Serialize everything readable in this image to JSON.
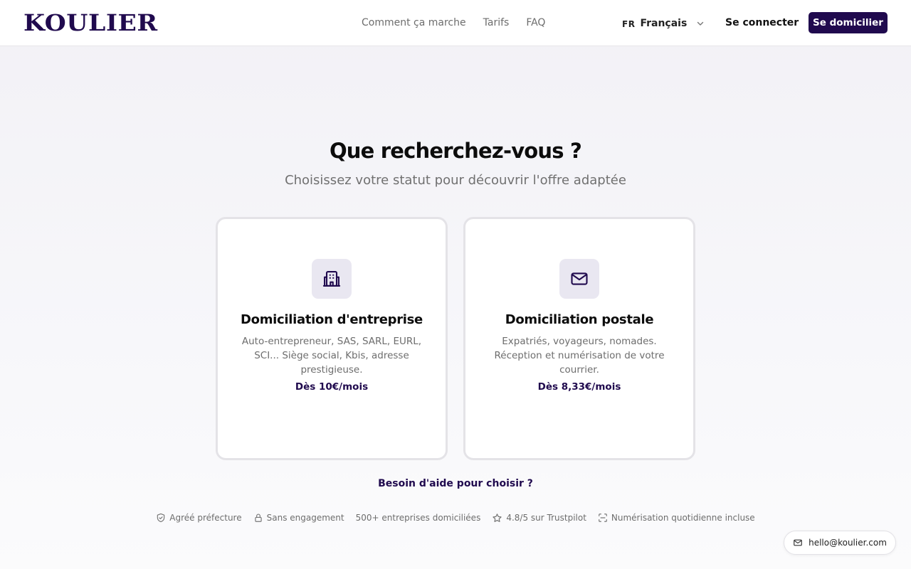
{
  "brand": {
    "logo_text": "KOULIER",
    "color": "#200a4e"
  },
  "nav": {
    "links": [
      "Comment ça marche",
      "Tarifs",
      "FAQ"
    ],
    "language": {
      "code": "FR",
      "label": "Français"
    },
    "login_label": "Se connecter",
    "cta_label": "Se domicilier"
  },
  "hero": {
    "title": "Que recherchez-vous ?",
    "subtitle": "Choisissez votre statut pour découvrir l'offre adaptée"
  },
  "cards": [
    {
      "icon": "building-icon",
      "title": "Domiciliation d'entreprise",
      "description": "Auto-entrepreneur, SAS, SARL, EURL, SCI... Siège social, Kbis, adresse prestigieuse.",
      "price": "Dès 10€/mois"
    },
    {
      "icon": "mail-icon",
      "title": "Domiciliation postale",
      "description": "Expatriés, voyageurs, nomades. Réception et numérisation de votre courrier.",
      "price": "Dès 8,33€/mois"
    }
  ],
  "help_link": "Besoin d'aide pour choisir ?",
  "badges": [
    {
      "icon": "shield-check-icon",
      "label": "Agréé préfecture"
    },
    {
      "icon": "lock-icon",
      "label": "Sans engagement"
    },
    {
      "icon": "",
      "label": "500+ entreprises domiciliées"
    },
    {
      "icon": "star-icon",
      "label": "4.8/5 sur Trustpilot"
    },
    {
      "icon": "scan-icon",
      "label": "Numérisation quotidienne incluse"
    }
  ],
  "contact": {
    "email": "hello@koulier.com"
  }
}
